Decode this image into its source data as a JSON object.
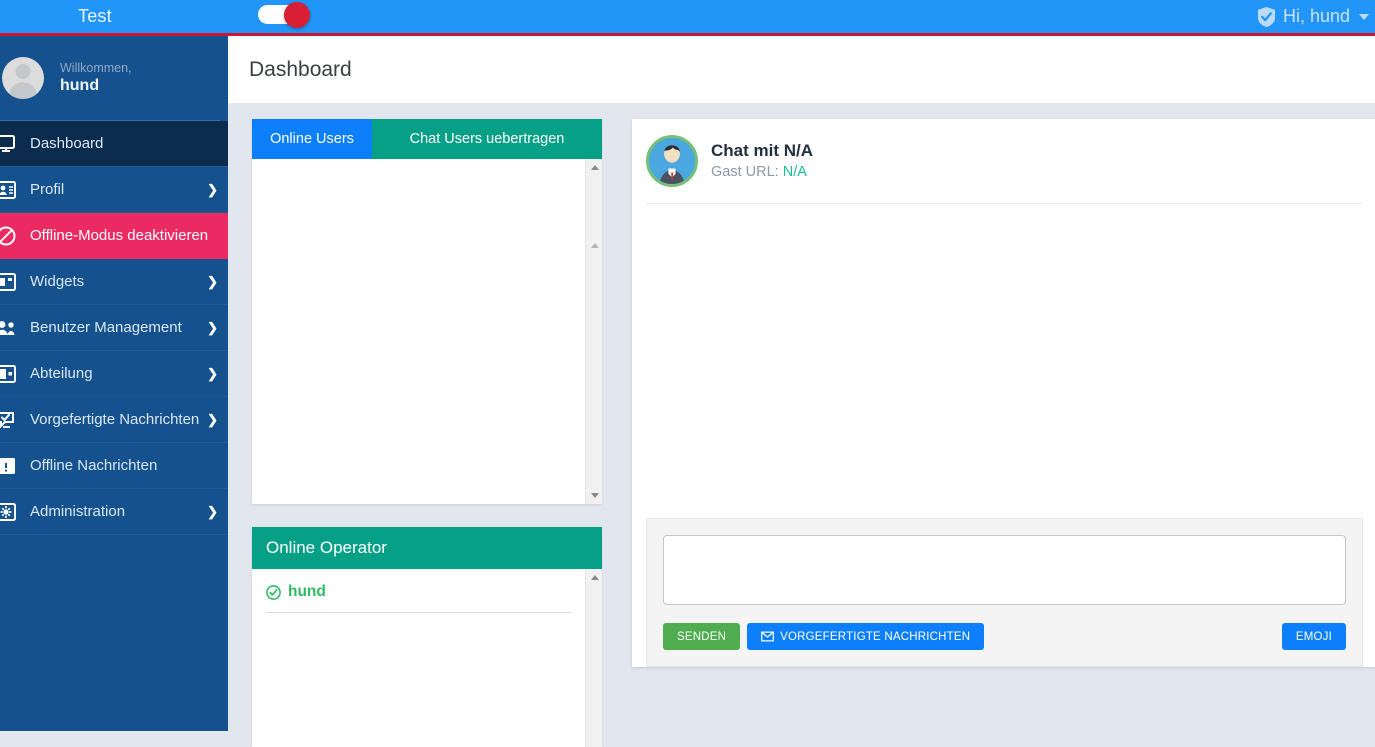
{
  "topbar": {
    "brand": "Test",
    "toggle_name": "offline-mode-toggle",
    "user_greeting": "Hi, hund",
    "shield_icon": "shield-check-icon",
    "caret_icon": "chevron-down-icon"
  },
  "sidebar": {
    "welcome_label": "Willkommen,",
    "user_name": "hund",
    "avatar_icon": "user-avatar-icon",
    "items": [
      {
        "label": "Dashboard",
        "icon": "monitor-icon",
        "state": "active",
        "arrow": false
      },
      {
        "label": "Profil",
        "icon": "id-card-icon",
        "state": "normal",
        "arrow": true
      },
      {
        "label": "Offline-Modus deaktivieren",
        "icon": "no-entry-icon",
        "state": "alert",
        "arrow": false
      },
      {
        "label": "Widgets",
        "icon": "widget-icon",
        "state": "normal",
        "arrow": true
      },
      {
        "label": "Benutzer Management",
        "icon": "users-icon",
        "state": "normal",
        "arrow": true
      },
      {
        "label": "Abteilung",
        "icon": "building-icon",
        "state": "normal",
        "arrow": true
      },
      {
        "label": "Vorgefertigte Nachrichten",
        "icon": "message-check-icon",
        "state": "normal",
        "arrow": true
      },
      {
        "label": "Offline Nachrichten",
        "icon": "envelope-alert-icon",
        "state": "normal",
        "arrow": false
      },
      {
        "label": "Administration",
        "icon": "gear-icon",
        "state": "normal",
        "arrow": true
      }
    ]
  },
  "page": {
    "title": "Dashboard"
  },
  "users_panel": {
    "tabs": [
      {
        "label": "Online Users",
        "active": true
      },
      {
        "label": "Chat Users uebertragen",
        "active": false
      }
    ],
    "list_items": [],
    "scrollbar": {
      "up_icon": "scroll-up-arrow-icon",
      "down_icon": "scroll-down-arrow-icon"
    }
  },
  "operator_panel": {
    "title": "Online Operator",
    "operators": [
      {
        "name": "hund",
        "status_icon": "check-circle-icon"
      }
    ],
    "scrollbar": {
      "up_icon": "scroll-up-arrow-icon"
    }
  },
  "chat": {
    "avatar_icon": "operator-avatar-icon",
    "title": "Chat mit N/A",
    "guest_url_label": "Gast URL:",
    "guest_url_value": "N/A",
    "messages": [],
    "composer": {
      "input_value": "",
      "input_placeholder": "",
      "send_label": "SENDEN",
      "canned_label": "VORGEFERTIGTE NACHRICHTEN",
      "canned_icon": "envelope-icon",
      "emoji_label": "EMOJI"
    }
  },
  "colors": {
    "topbar_blue": "#2196f8",
    "sidebar_blue": "#14518d",
    "sidebar_active": "#0c2c4d",
    "alert_pink": "#ec2a62",
    "red_line": "#cf1733",
    "teal": "#06a086",
    "tab_blue": "#0d7ffb",
    "green": "#4fad4f",
    "operator_green": "#2fbd62",
    "page_bg": "#e2e6ee"
  }
}
